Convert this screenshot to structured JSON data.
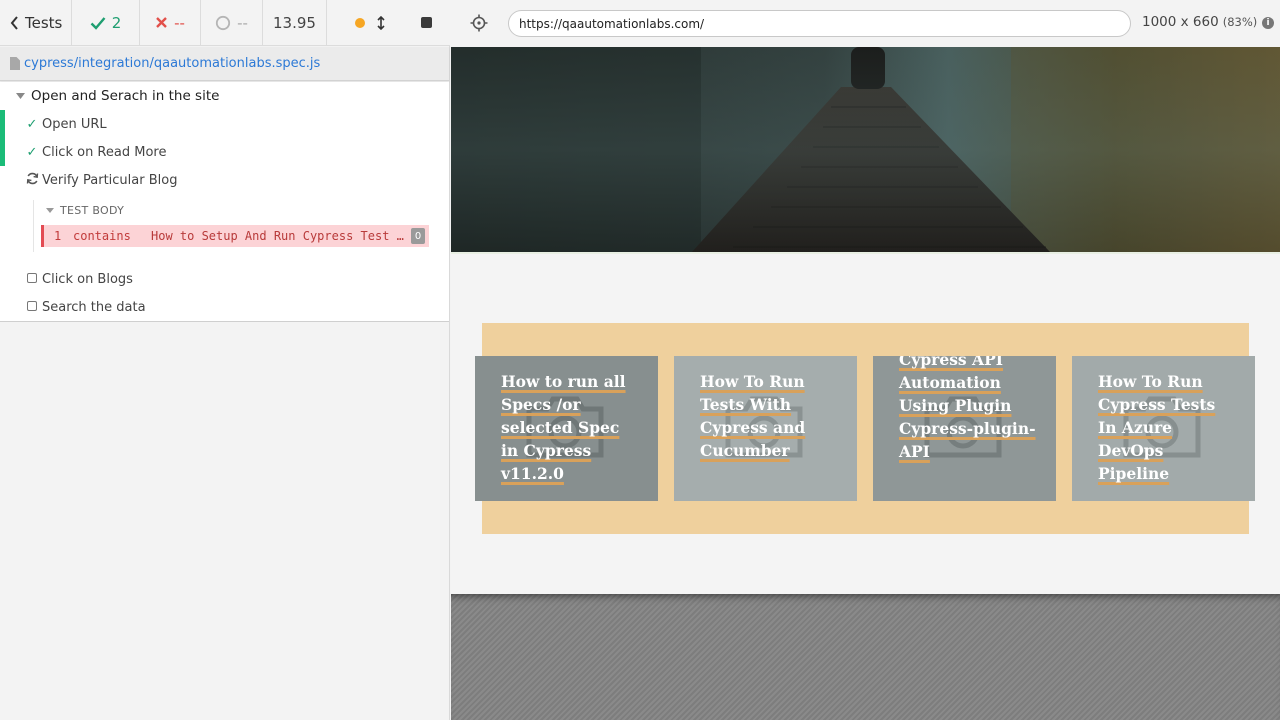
{
  "reporter": {
    "back_label": "Tests",
    "passed_count": "2",
    "failed_count": "--",
    "pending_count": "--",
    "duration": "13.95",
    "spec_path": "cypress/integration/qaautomationlabs.spec.js",
    "suite_title": "Open and Serach in the site",
    "tests": [
      {
        "label": "Open URL",
        "state": "passed"
      },
      {
        "label": "Click on Read More",
        "state": "passed"
      },
      {
        "label": "Verify Particular Blog",
        "state": "running"
      },
      {
        "label": "Click on Blogs",
        "state": "pending"
      },
      {
        "label": "Search the data",
        "state": "pending"
      }
    ],
    "test_body_label": "TEST BODY",
    "command": {
      "number": "1",
      "name": "contains",
      "message": "How to Setup And Run Cypress Test Cases in CI/CD TeamCity",
      "badge": "0"
    }
  },
  "aut": {
    "url": "https://qaautomationlabs.com/",
    "viewport": "1000 x 660",
    "scale": "(83%)",
    "info_icon": "i"
  },
  "blog_cards": [
    {
      "title": "How to run all Specs /or selected Spec in Cypress v11.2.0",
      "color": "#878f8f"
    },
    {
      "title": "How To Run Tests With Cypress and Cucumber",
      "color": "#a5adad"
    },
    {
      "title": "Cypress API Automation Using Plugin Cypress-plugin-API",
      "color": "#8f9797"
    },
    {
      "title": "How To Run Cypress Tests In Azure DevOps Pipeline",
      "color": "#a2aaaa"
    }
  ],
  "colors": {
    "passed": "#1e9e70",
    "failed": "#e2504a",
    "accent_link": "#2c79d6",
    "command_error_bg": "#fcd3d6",
    "blogs_panel": "#efd09d"
  }
}
